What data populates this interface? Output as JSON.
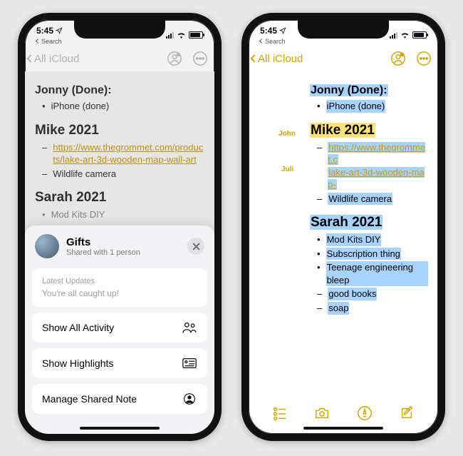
{
  "accent": "#d1a500",
  "status": {
    "time": "5:45",
    "search_label": "Search"
  },
  "nav": {
    "back_label": "All iCloud"
  },
  "left": {
    "sections": {
      "jonny": {
        "title": "Jonny (Done):",
        "items": [
          "iPhone (done)"
        ]
      },
      "mike": {
        "title": "Mike 2021",
        "link": "https://www.thegrommet.com/products/lake-art-3d-wooden-map-wall-art",
        "item2": "Wildlife camera"
      },
      "sarah": {
        "title": "Sarah 2021",
        "item1_partial": "Mod Kits DIY"
      }
    },
    "sheet": {
      "title": "Gifts",
      "subtitle": "Shared with 1 person",
      "updates_label": "Latest Updates",
      "updates_msg": "You're all caught up!",
      "show_activity": "Show All Activity",
      "show_highlights": "Show Highlights",
      "manage": "Manage Shared Note"
    }
  },
  "right": {
    "annotations": {
      "john": "John",
      "juli": "Juli"
    },
    "sections": {
      "jonny": {
        "title": "Jonny (Done):",
        "items": [
          "iPhone (done)"
        ]
      },
      "mike": {
        "title": "Mike 2021",
        "link_l1": "https://www.thegrommet.c",
        "link_l2": "lake-art-3d-wooden-map-",
        "item2": "Wildlife camera"
      },
      "sarah": {
        "title": "Sarah 2021",
        "items": [
          "Mod Kits DIY",
          "Subscription thing",
          "Teenage engineering bleep",
          "good books",
          "soap"
        ]
      }
    }
  }
}
